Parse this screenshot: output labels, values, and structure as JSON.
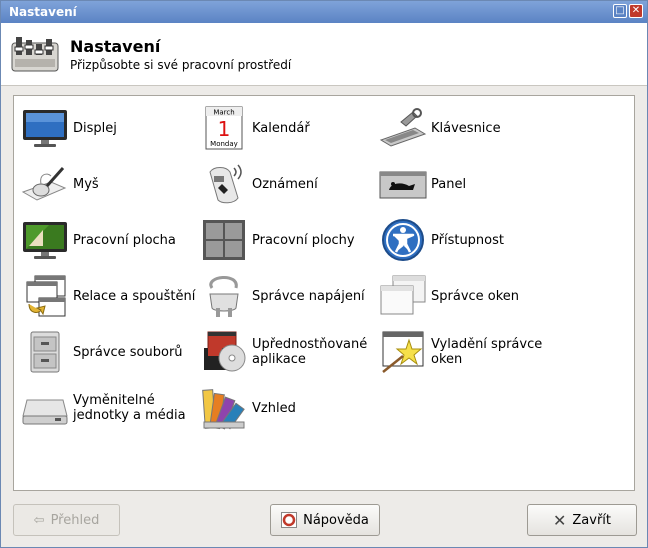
{
  "window": {
    "title": "Nastavení"
  },
  "header": {
    "title": "Nastavení",
    "subtitle": "Přizpůsobte si své pracovní prostředí"
  },
  "items": [
    {
      "label": "Displej",
      "icon": "monitor-icon"
    },
    {
      "label": "Kalendář",
      "icon": "calendar-icon",
      "icon_text": [
        "March",
        "1",
        "Monday"
      ]
    },
    {
      "label": "Klávesnice",
      "icon": "keyboard-icon"
    },
    {
      "label": "Myš",
      "icon": "mouse-icon"
    },
    {
      "label": "Oznámení",
      "icon": "notification-icon"
    },
    {
      "label": "Panel",
      "icon": "panel-icon"
    },
    {
      "label": "Pracovní plocha",
      "icon": "desktop-icon"
    },
    {
      "label": "Pracovní plochy",
      "icon": "workspaces-icon"
    },
    {
      "label": "Přístupnost",
      "icon": "accessibility-icon"
    },
    {
      "label": "Relace a spouštění",
      "icon": "session-icon"
    },
    {
      "label": "Správce napájení",
      "icon": "power-plug-icon"
    },
    {
      "label": "Správce oken",
      "icon": "window-manager-icon"
    },
    {
      "label": "Správce souborů",
      "icon": "file-cabinet-icon"
    },
    {
      "label": "Upřednostňované aplikace",
      "icon": "preferred-apps-icon"
    },
    {
      "label": "Vyladění správce oken",
      "icon": "window-tweaks-icon"
    },
    {
      "label": "Vyměnitelné jednotky a média",
      "icon": "removable-drive-icon"
    },
    {
      "label": "Vzhled",
      "icon": "color-swatches-icon"
    }
  ],
  "footer": {
    "back_label": "Přehled",
    "help_label": "Nápověda",
    "close_label": "Zavřít"
  },
  "colors": {
    "titlebar": "#5b83c4",
    "accent": "#2f6fc1"
  }
}
